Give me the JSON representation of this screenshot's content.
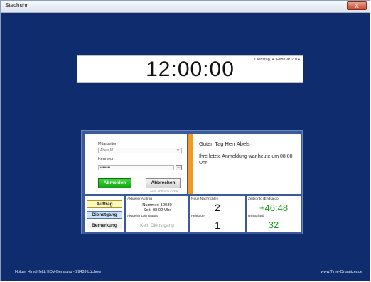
{
  "window": {
    "title": "Stechuhr",
    "close_label": "X"
  },
  "clock": {
    "time": "12:00:00",
    "date": "Dienstag, 4. Februar 2014"
  },
  "login": {
    "mitarbeiter_label": "Mitarbeiter",
    "mitarbeiter_value": "Abels,M.",
    "kennwort_label": "Kennwort",
    "kennwort_value": "••••••••",
    "dots_button": "...",
    "abmelden_label": "Abmelden",
    "abbrechen_label": "Abbrechen",
    "auto_abbruch": "Auto Abbruch in 29s"
  },
  "greeting": {
    "title": "Guten Tag Herr Abels",
    "message": "Ihre letzte Anmeldung war heute um 08:00 Uhr"
  },
  "side_buttons": {
    "auftrag": "Auftrag",
    "dienstgang": "Dienstgang",
    "bemerkung": "Bemerkung"
  },
  "auftrag_cell": {
    "label": "Aktueller Auftrag",
    "nummer": "Nummer: 10030",
    "seit": "Seit: 08:02 Uhr",
    "dienstgang_label": "Aktueller Dienstgang",
    "dienstgang_value": "Kein Dienstgang"
  },
  "nachrichten_cell": {
    "label": "Neue Nachrichten",
    "value": "2",
    "fehltage_label": "Fehltage",
    "fehltage_value": "1"
  },
  "zeitkonto_cell": {
    "label": "Zeitkonto (Endsaldo)",
    "value": "+46:48",
    "resturlaub_label": "Resturlaub",
    "resturlaub_value": "32"
  },
  "footer": {
    "left": "Holger Hirschfeldt EDV-Beratung - 29439 Lüchow",
    "right": "www.Time-Organizer.de"
  },
  "colors": {
    "background": "#0f2d6e",
    "panel": "#3a5a9a",
    "accent_orange": "#f39a1e",
    "positive_green": "#1a9a1a"
  }
}
